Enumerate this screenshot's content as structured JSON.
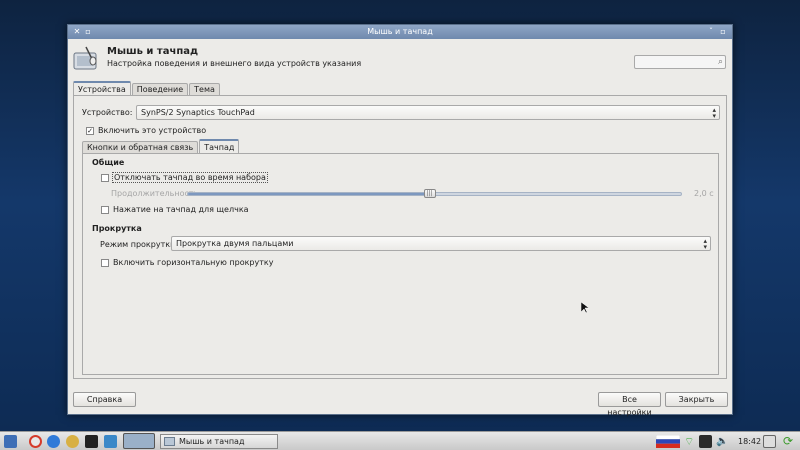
{
  "window": {
    "title": "Мышь и тачпад",
    "heading": "Мышь и тачпад",
    "subtitle": "Настройка поведения и внешнего вида устройств указания",
    "search_placeholder": ""
  },
  "tabs": [
    {
      "label": "Устройства",
      "active": true
    },
    {
      "label": "Поведение",
      "active": false
    },
    {
      "label": "Тема",
      "active": false
    }
  ],
  "device": {
    "label": "Устройство:",
    "value": "SynPS/2 Synaptics TouchPad",
    "enable_label": "Включить это устройство",
    "enable_checked": true
  },
  "inner_tabs": [
    {
      "label": "Кнопки и обратная связь",
      "active": false
    },
    {
      "label": "Тачпад",
      "active": true
    }
  ],
  "touchpad": {
    "general_heading": "Общие",
    "disable_while_typing": {
      "label": "Отключать тачпад во время набора",
      "checked": false
    },
    "duration": {
      "label": "Продолжительность:",
      "value_text": "2,0 с",
      "fraction": 0.49
    },
    "tap_to_click": {
      "label": "Нажатие на тачпад для щелчка",
      "checked": false
    },
    "scroll_heading": "Прокрутка",
    "scroll_mode": {
      "label": "Режим прокрутки:",
      "value": "Прокрутка двумя пальцами"
    },
    "horizontal_scroll": {
      "label": "Включить горизонтальную прокрутку",
      "checked": false
    }
  },
  "buttons": {
    "help": "Справка",
    "all_settings": "Все настройки",
    "close": "Закрыть"
  },
  "taskbar": {
    "task_label": "Мышь и тачпад",
    "clock": "18:42",
    "colors": {
      "flag_white": "#ffffff",
      "flag_blue": "#2b46b8",
      "flag_red": "#d52b1e"
    }
  }
}
